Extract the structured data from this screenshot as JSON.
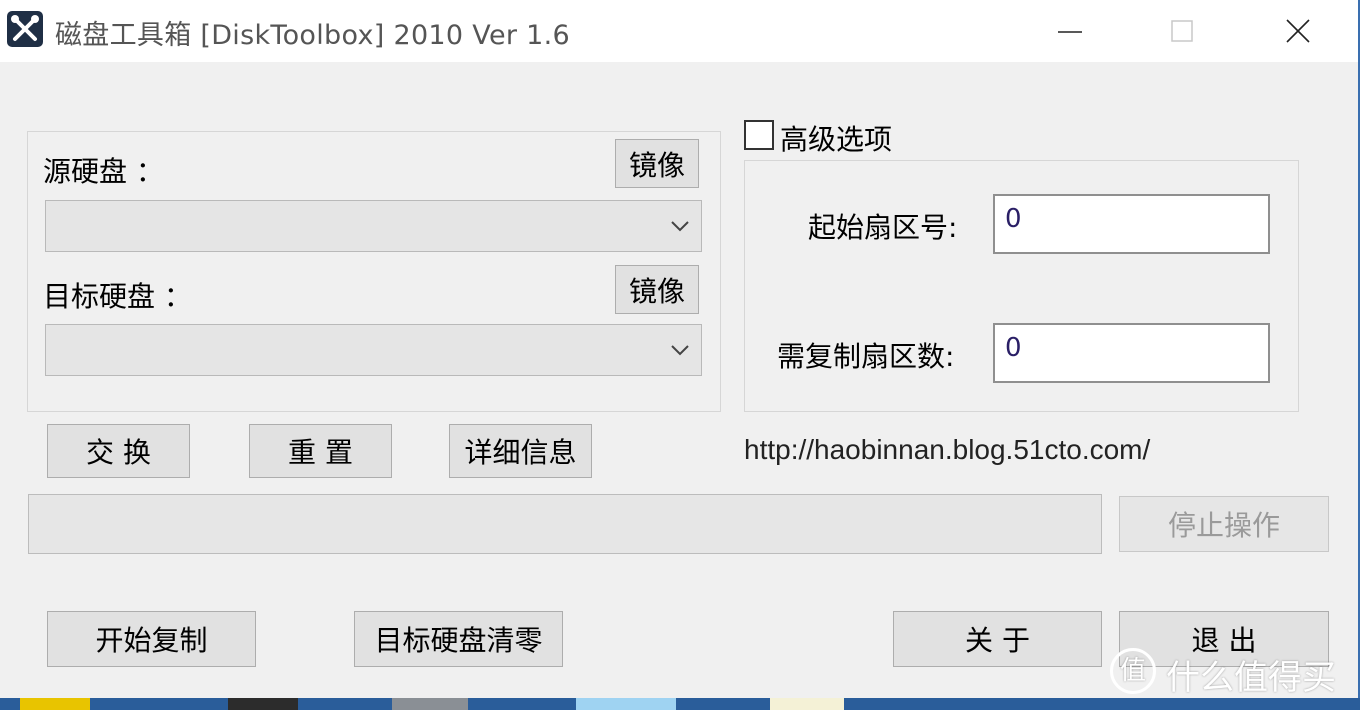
{
  "window": {
    "title": "磁盘工具箱 [DiskToolbox] 2010 Ver 1.6",
    "app_icon": "crossed-tools-icon",
    "controls": [
      "minimize-icon",
      "maximize-icon",
      "close-icon"
    ]
  },
  "main": {
    "source_label": "源硬盘 ：",
    "target_label": "目标硬盘 ：",
    "source_mirror_button": "镜像",
    "target_mirror_button": "镜像",
    "source_select_value": "",
    "target_select_value": "",
    "swap_button": "交 换",
    "reset_button": "重 置",
    "details_button": "详细信息"
  },
  "advanced": {
    "checkbox_label": "高级选项",
    "checked": false,
    "start_sector_label": "起始扇区号:",
    "start_sector_value": "0",
    "sector_count_label": "需复制扇区数:",
    "sector_count_value": "0"
  },
  "url": "http://haobinnan.blog.51cto.com/",
  "progress": {
    "value": 0
  },
  "stop_button": "停止操作",
  "bottom_buttons": {
    "start_copy": "开始复制",
    "wipe_target": "目标硬盘清零",
    "about": "关 于",
    "exit": "退 出"
  },
  "watermark": {
    "logo": "值",
    "text": "什么值得买"
  },
  "colors": {
    "window_bg": "#f0f0f0",
    "title_bar": "#ffffff",
    "button_bg": "#e1e1e1",
    "disabled_text": "#9a9a9a",
    "taskbar": "#2a5d9a"
  }
}
